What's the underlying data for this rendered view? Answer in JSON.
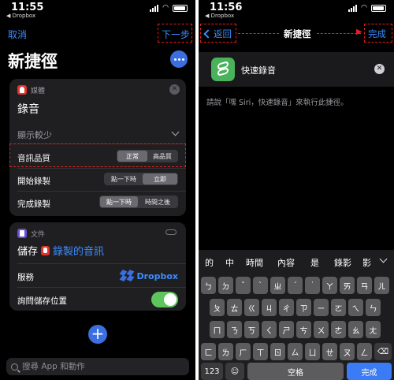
{
  "left": {
    "time": "11:55",
    "back_app": "◀ Dropbox",
    "cancel": "取消",
    "next": "下一步",
    "title": "新捷徑",
    "record_card": {
      "app": "媒體",
      "action": "錄音",
      "show_less": "顯示較少",
      "quality_label": "音訊品質",
      "quality_options": [
        "正常",
        "高品質"
      ],
      "start_label": "開始錄製",
      "start_options": [
        "點一下時",
        "立即"
      ],
      "finish_label": "完成錄製",
      "finish_options": [
        "點一下時",
        "時間之後"
      ]
    },
    "save_card": {
      "app": "文件",
      "save_word": "儲存",
      "variable": "錄製的音訊",
      "service_label": "服務",
      "service_value": "Dropbox",
      "ask_label": "詢問儲存位置"
    },
    "add": "+",
    "search_placeholder": "搜尋 App 和動作"
  },
  "right": {
    "time": "11:56",
    "back_app": "◀ Dropbox",
    "back": "返回",
    "title": "新捷徑",
    "done": "完成",
    "shortcut_name": "快速錄音",
    "hint": "請說「嘿 Siri，快速錄音」來執行此捷徑。",
    "candidates": [
      "的",
      "中",
      "時間",
      "內容",
      "是",
      "錄影",
      "影"
    ],
    "row1": [
      "ㄅ",
      "ㄉ",
      "ˇ",
      "ˋ",
      "ㄓ",
      "ˊ",
      "˙",
      "ㄚ",
      "ㄞ",
      "ㄢ",
      "ㄦ"
    ],
    "row2": [
      "ㄆ",
      "ㄊ",
      "ㄍ",
      "ㄐ",
      "ㄔ",
      "ㄗ",
      "ㄧ",
      "ㄛ",
      "ㄟ",
      "ㄣ"
    ],
    "row3": [
      "ㄇ",
      "ㄋ",
      "ㄎ",
      "ㄑ",
      "ㄕ",
      "ㄘ",
      "ㄨ",
      "ㄜ",
      "ㄠ",
      "ㄤ"
    ],
    "row4": [
      "ㄈ",
      "ㄌ",
      "ㄏ",
      "ㄒ",
      "ㄖ",
      "ㄙ",
      "ㄩ",
      "ㄝ",
      "ㄡ",
      "ㄥ",
      "⌫"
    ],
    "bottom": {
      "num": "123",
      "emoji": "☺",
      "space": "空格",
      "done": "完成"
    }
  },
  "colors": {
    "accent": "#3b8cff",
    "annotation": "#e0201c",
    "toggle_on": "#5dc45e"
  }
}
